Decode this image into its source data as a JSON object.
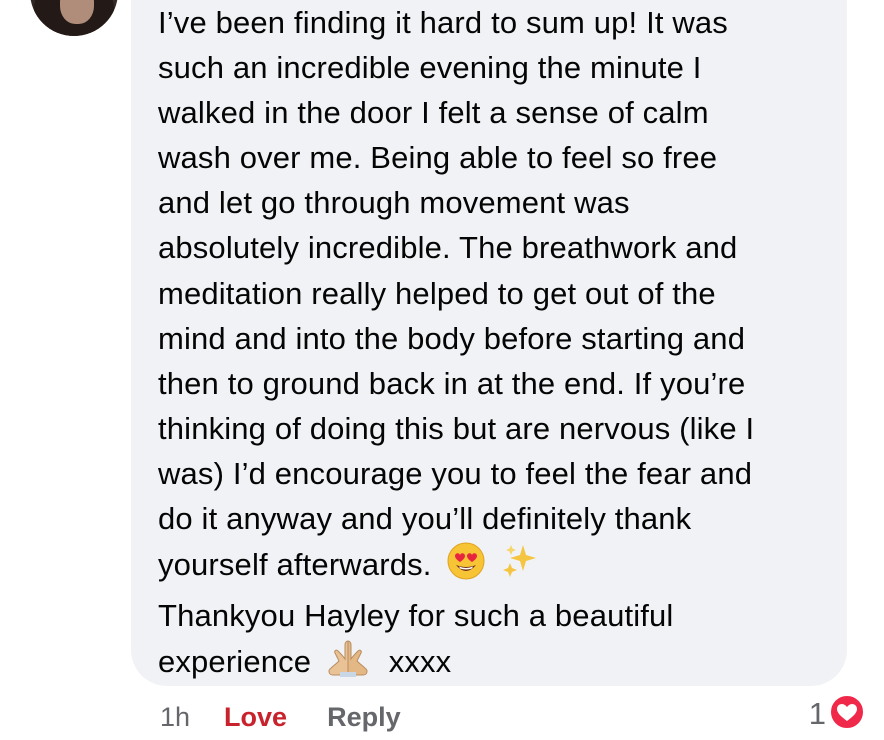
{
  "comment": {
    "lines": [
      "I’ve been finding it hard to sum up! It was",
      "such an incredible evening the minute I",
      "walked in the door I felt a sense of calm",
      "wash over me. Being able to feel so free",
      "and let go through movement was",
      "absolutely incredible. The breathwork and",
      "meditation really helped to get out of the",
      "mind and into the body before starting and",
      "then to ground back in at the end. If you’re",
      "thinking of doing this but are nervous (like I",
      "was) I’d encourage you to feel the fear and",
      "do it anyway and you’ll definitely thank",
      "yourself afterwards.",
      "Thankyou Hayley for such a beautiful",
      "experience",
      "xxxx"
    ],
    "emojis": {
      "heart_eyes": "smiling-face-with-heart-eyes-icon",
      "sparkles": "sparkles-icon",
      "praying_hands": "folded-hands-icon"
    }
  },
  "actions": {
    "time": "1h",
    "love_label": "Love",
    "reply_label": "Reply"
  },
  "reactions": {
    "count": "1",
    "icon": "heart-reaction-icon"
  },
  "colors": {
    "bubble_bg": "#f0f2f5",
    "text": "#050505",
    "muted": "#65676b",
    "love": "#c8232c",
    "heart_reaction": "#f0284a"
  }
}
